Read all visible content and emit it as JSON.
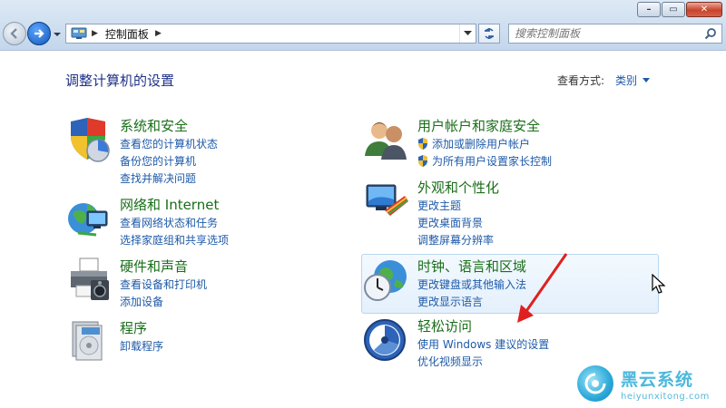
{
  "window": {
    "minimize_label": "–",
    "maximize_label": "▭",
    "close_label": "✕"
  },
  "address_bar": {
    "breadcrumb": "控制面板",
    "icon": "control-panel-icon"
  },
  "search": {
    "placeholder": "搜索控制面板"
  },
  "header": {
    "title": "调整计算机的设置",
    "view_by_label": "查看方式:",
    "view_by_value": "类别"
  },
  "categories_left": [
    {
      "icon": "shield-security-icon",
      "title": "系统和安全",
      "links": [
        "查看您的计算机状态",
        "备份您的计算机",
        "查找并解决问题"
      ]
    },
    {
      "icon": "network-globe-icon",
      "title": "网络和 Internet",
      "links": [
        "查看网络状态和任务",
        "选择家庭组和共享选项"
      ]
    },
    {
      "icon": "printer-icon",
      "title": "硬件和声音",
      "links": [
        "查看设备和打印机",
        "添加设备"
      ]
    },
    {
      "icon": "programs-icon",
      "title": "程序",
      "links": [
        "卸载程序"
      ]
    }
  ],
  "categories_right": [
    {
      "icon": "users-icon",
      "title": "用户帐户和家庭安全",
      "links": [
        "添加或删除用户帐户",
        "为所有用户设置家长控制"
      ]
    },
    {
      "icon": "appearance-icon",
      "title": "外观和个性化",
      "links": [
        "更改主题",
        "更改桌面背景",
        "调整屏幕分辨率"
      ]
    },
    {
      "icon": "clock-globe-icon",
      "title": "时钟、语言和区域",
      "links": [
        "更改键盘或其他输入法",
        "更改显示语言"
      ]
    },
    {
      "icon": "ease-of-access-icon",
      "title": "轻松访问",
      "links": [
        "使用 Windows 建议的设置",
        "优化视频显示"
      ]
    }
  ],
  "watermark": {
    "name_cn": "黑云系统",
    "domain": "heiyunxitong.com"
  },
  "colors": {
    "title_green": "#1a6e1a",
    "link_blue": "#1e5aa8",
    "header_blue": "#1e3287",
    "annotation_red": "#e02020"
  }
}
